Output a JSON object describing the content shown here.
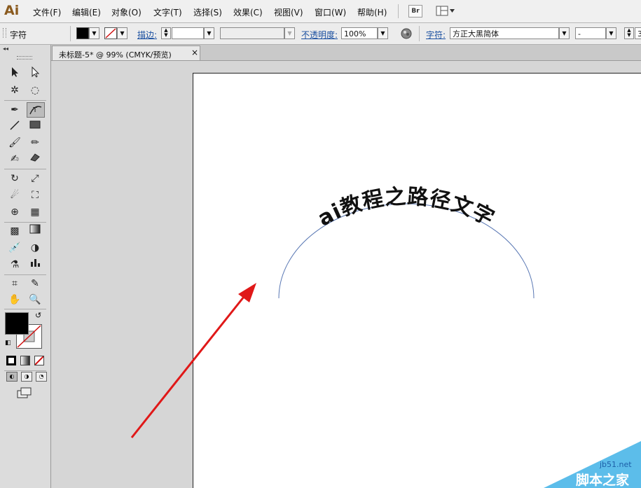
{
  "app": {
    "logo": "Ai"
  },
  "menu": [
    "文件(F)",
    "编辑(E)",
    "对象(O)",
    "文字(T)",
    "选择(S)",
    "效果(C)",
    "视图(V)",
    "窗口(W)",
    "帮助(H)"
  ],
  "menubar_icons": {
    "bridge": "Br",
    "workspace": "workspace-switcher-icon"
  },
  "control": {
    "selection_label": "字符",
    "stroke_label": "描边:",
    "opacity_label": "不透明度:",
    "opacity_value": "100%",
    "char_label": "字符:",
    "font_value": "方正大黑简体",
    "font_style_value": "-",
    "size_partial": "3"
  },
  "tab": {
    "title": "未标题-5* @ 99% (CMYK/预览)",
    "close": "×"
  },
  "canvas": {
    "path_text": "ai教程之路径文字",
    "path_color": "#5a78b4",
    "arrow_color": "#e01818"
  },
  "watermark": {
    "site": "jb51.net",
    "name": "脚本之家"
  },
  "colors": {
    "fill": "#000000",
    "stroke": "none"
  }
}
